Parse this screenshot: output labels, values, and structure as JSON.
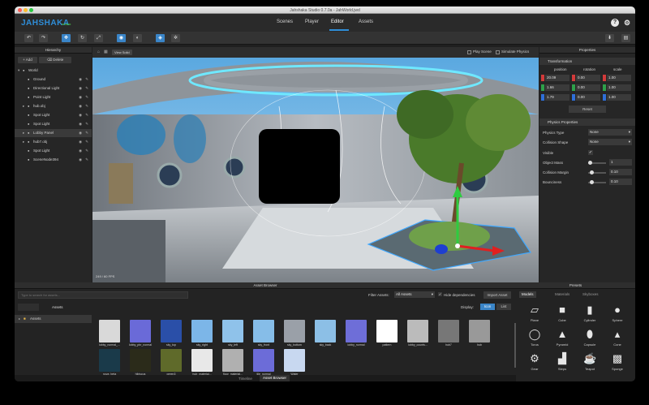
{
  "window": {
    "title": "Jahshaka Studio 0.7.0a - JahWorld.jwd"
  },
  "app": {
    "logo": "JAHSHAKA",
    "logo_sub": "STUDIO"
  },
  "menu": [
    {
      "label": "Scenes"
    },
    {
      "label": "Player"
    },
    {
      "label": "Editor",
      "active": true
    },
    {
      "label": "Assets"
    }
  ],
  "hierarchy": {
    "title": "Hierarchy",
    "add_label": "+ Add",
    "delete_label": "⌫ Delete",
    "items": [
      {
        "label": "World",
        "depth": 0
      },
      {
        "label": "Ground",
        "depth": 1
      },
      {
        "label": "Directional Light",
        "depth": 1
      },
      {
        "label": "Point Light",
        "depth": 1
      },
      {
        "label": "hub.obj",
        "depth": 1,
        "expandable": true
      },
      {
        "label": "Spot Light",
        "depth": 1
      },
      {
        "label": "Spot Light",
        "depth": 1
      },
      {
        "label": "Lobby Panel",
        "depth": 1,
        "expandable": true,
        "selected": true
      },
      {
        "label": "hub7.obj",
        "depth": 1,
        "expandable": true
      },
      {
        "label": "Spot Light",
        "depth": 1
      },
      {
        "label": "SceneNode394",
        "depth": 1
      }
    ]
  },
  "viewport": {
    "view_label": "View Solid",
    "play_scene": "Play Scene",
    "simulate_physics": "Simulate Physics",
    "fps_label": "249 / 60 FPS"
  },
  "properties": {
    "title": "Properties",
    "transformation": {
      "title": "Transformation",
      "headers": [
        "position",
        "rotation",
        "scale"
      ],
      "rows": [
        [
          "20.09",
          "0.00",
          "1.00"
        ],
        [
          "1.66",
          "0.00",
          "1.00"
        ],
        [
          "1.79",
          "0.00",
          "1.00"
        ]
      ],
      "reset_label": "Reset"
    },
    "physics": {
      "title": "Physics Properties",
      "physics_type_label": "Physics Type",
      "physics_type_value": "None",
      "collision_shape_label": "Collision Shape",
      "collision_shape_value": "None",
      "visible_label": "Visible",
      "visible_checked": true,
      "object_mass_label": "Object Mass",
      "object_mass_value": "1",
      "collision_margin_label": "Collision Margin",
      "collision_margin_value": "0.10",
      "bounciness_label": "Bounciness",
      "bounciness_value": "0.10"
    }
  },
  "asset_browser": {
    "title": "Asset Browser",
    "search_placeholder": "Type to search for assets...",
    "filter_label": "Filter Assets:",
    "filter_value": "All Assets",
    "hide_dependencies": "Hide dependencies",
    "import_label": "Import Asset",
    "folder_header": "Assets",
    "folder_item": "Assets",
    "display_label": "Display:",
    "display_icon": "Icon",
    "display_list": "List",
    "assets": [
      {
        "label": "lobby_normal_...",
        "color": "#d9d9d9"
      },
      {
        "label": "lobby_pbr_normal",
        "color": "#6a6ad8"
      },
      {
        "label": "sky_top",
        "color": "#2a4fa8"
      },
      {
        "label": "sky_right",
        "color": "#7cb6e8"
      },
      {
        "label": "sky_left",
        "color": "#8fc2ea"
      },
      {
        "label": "sky_front",
        "color": "#86bde8"
      },
      {
        "label": "sky_bottom",
        "color": "#9aa0a8"
      },
      {
        "label": "sky_back",
        "color": "#8cbfe6"
      },
      {
        "label": "lobby_normal",
        "color": "#6e6ed8"
      },
      {
        "label": "pattern",
        "color": "#ffffff"
      },
      {
        "label": "lobby_counts...",
        "color": "#bbbbbb"
      },
      {
        "label": "hub7",
        "color": "#777777"
      },
      {
        "label": "hub",
        "color": "#999999"
      },
      {
        "label": "nova_beta",
        "color": "#1a3a4a"
      },
      {
        "label": "hibiscus",
        "color": "#2b2b1a"
      },
      {
        "label": "green3",
        "color": "#5f6a2a"
      },
      {
        "label": "hub_material...",
        "color": "#e8e8e8"
      },
      {
        "label": "floor_material...",
        "color": "#b0b0b0"
      },
      {
        "label": "tile_normal",
        "color": "#6c6cd8"
      },
      {
        "label": "Water",
        "color": "#c8d8f0"
      }
    ],
    "bottom_tabs": [
      {
        "label": "Timeline"
      },
      {
        "label": "Asset Browser",
        "active": true
      }
    ]
  },
  "presets": {
    "title": "Presets",
    "tabs": [
      {
        "label": "Models",
        "active": true
      },
      {
        "label": "Materials"
      },
      {
        "label": "Skyboxes"
      }
    ],
    "shapes": [
      {
        "label": "Plane",
        "icon": "plane-icon"
      },
      {
        "label": "Cube",
        "icon": "cube-icon"
      },
      {
        "label": "Cylinder",
        "icon": "cylinder-icon"
      },
      {
        "label": "Sphere",
        "icon": "sphere-icon"
      },
      {
        "label": "Torus",
        "icon": "torus-icon"
      },
      {
        "label": "Pyramid",
        "icon": "pyramid-icon"
      },
      {
        "label": "Capsule",
        "icon": "capsule-icon"
      },
      {
        "label": "Cone",
        "icon": "cone-icon"
      },
      {
        "label": "Gear",
        "icon": "gear-shape-icon"
      },
      {
        "label": "Steps",
        "icon": "steps-icon"
      },
      {
        "label": "Teapot",
        "icon": "teapot-icon"
      },
      {
        "label": "Sponge",
        "icon": "sponge-icon"
      }
    ]
  },
  "colors": {
    "accent": "#3a85c8",
    "axis_x": "#d23a3a",
    "axis_y": "#2ea04a",
    "axis_z": "#2f6fd8"
  }
}
